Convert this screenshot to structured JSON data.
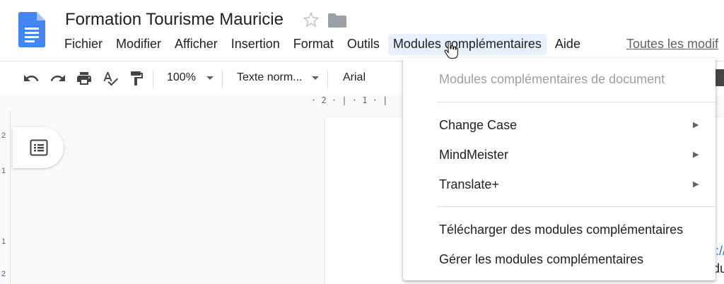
{
  "document": {
    "title": "Formation Tourisme Mauricie"
  },
  "menubar": {
    "items": [
      {
        "label": "Fichier"
      },
      {
        "label": "Modifier"
      },
      {
        "label": "Afficher"
      },
      {
        "label": "Insertion"
      },
      {
        "label": "Format"
      },
      {
        "label": "Outils"
      },
      {
        "label": "Modules complémentaires"
      },
      {
        "label": "Aide"
      }
    ],
    "last_edit": "Toutes les modif"
  },
  "toolbar": {
    "zoom": "100%",
    "style": "Texte norm...",
    "font": "Arial"
  },
  "ruler": {
    "marks": "· 2 · | · 1 · |"
  },
  "vruler": {
    "tick_2a": "2",
    "tick_1a": "1",
    "tick_1b": "1",
    "tick_2b": "2"
  },
  "page": {
    "link_fragment": "://",
    "text_fragment": "du"
  },
  "dropdown": {
    "header": "Modules complémentaires de document",
    "items": [
      {
        "label": "Change Case"
      },
      {
        "label": "MindMeister"
      },
      {
        "label": "Translate+"
      }
    ],
    "actions": [
      {
        "label": "Télécharger des modules complémentaires"
      },
      {
        "label": "Gérer les modules complémentaires"
      }
    ],
    "submenu_arrow": "▶"
  },
  "colors": {
    "accent": "#1a73e8",
    "active_menu_bg": "#e8f0fe",
    "doc_icon": "#4285f4"
  }
}
